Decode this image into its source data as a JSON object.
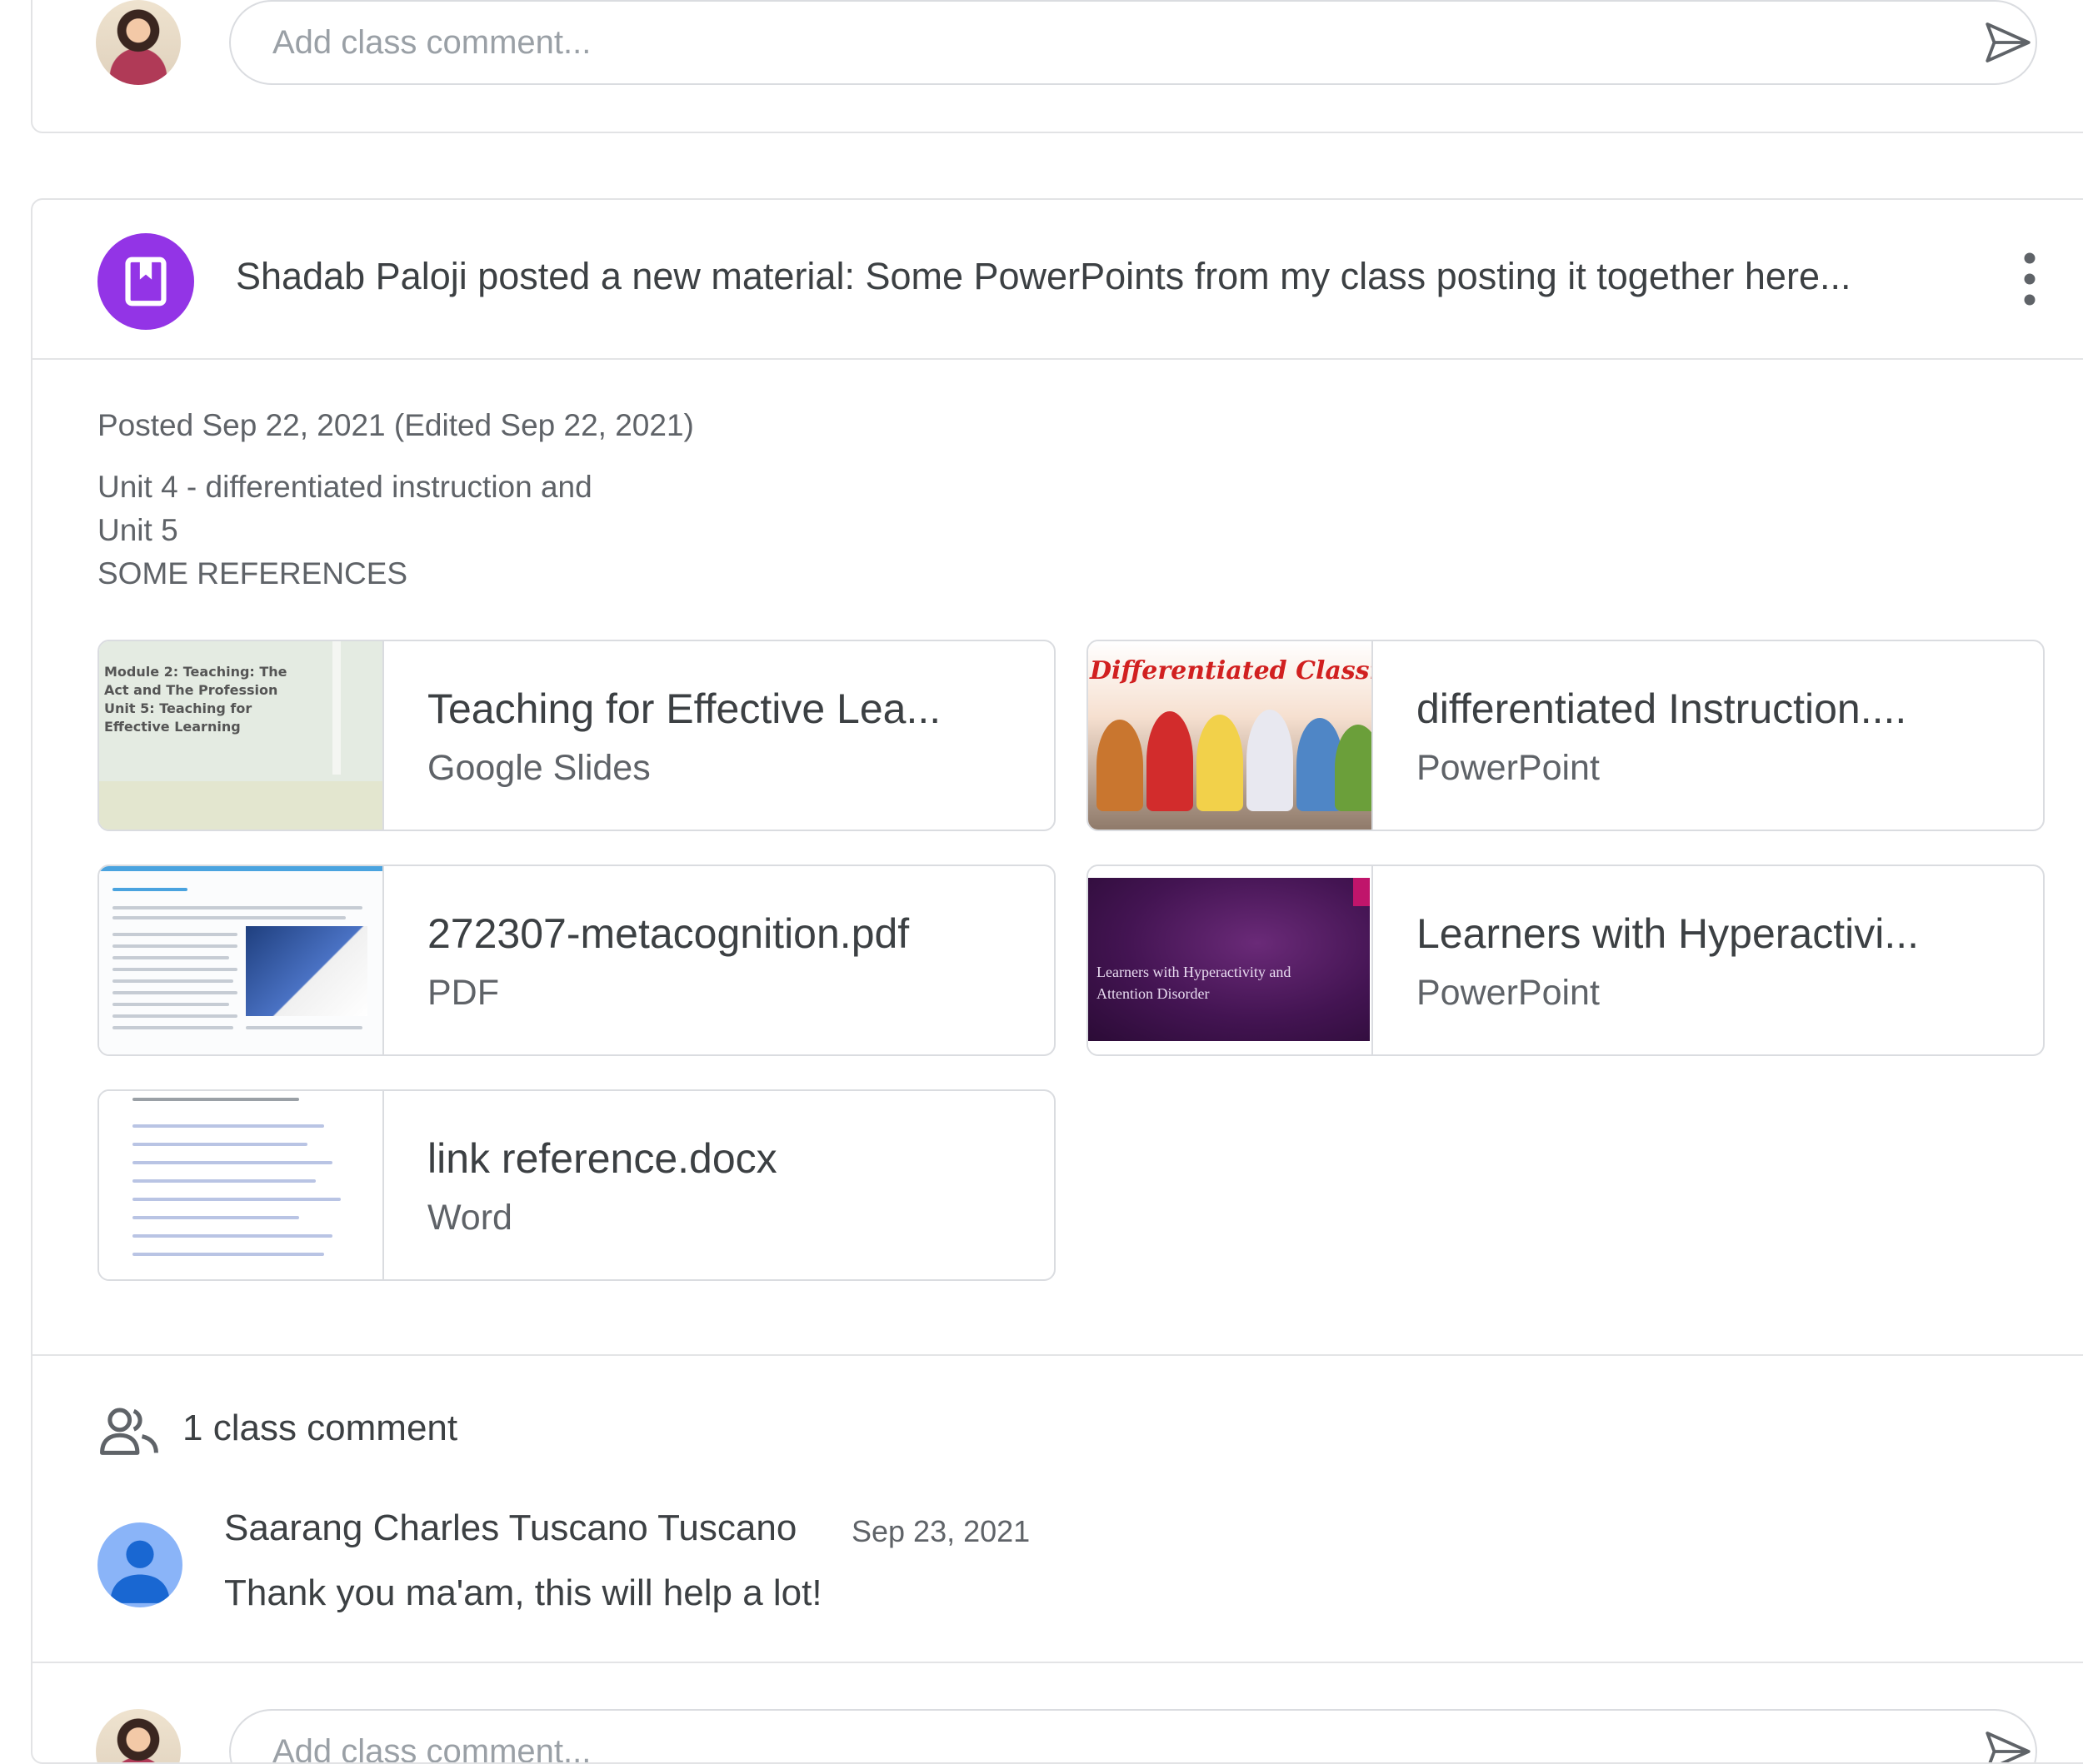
{
  "top_comment": {
    "placeholder": "Add class comment..."
  },
  "post": {
    "title": "Shadab Paloji posted a new material: Some PowerPoints from my class posting it together here...",
    "posted": "Posted Sep 22, 2021 (Edited Sep 22, 2021)",
    "description": [
      "Unit 4 - differentiated instruction and",
      "Unit 5",
      "SOME REFERENCES"
    ],
    "attachments": [
      {
        "title": "Teaching for Effective Lea...",
        "type": "Google Slides",
        "thumb_text": "Module 2: Teaching: The Act and The Profession Unit 5: Teaching for Effective Learning"
      },
      {
        "title": "differentiated Instruction....",
        "type": "PowerPoint",
        "thumb_text": "Differentiated Classr"
      },
      {
        "title": "272307-metacognition.pdf",
        "type": "PDF"
      },
      {
        "title": "Learners with Hyperactivi...",
        "type": "PowerPoint",
        "thumb_text": "Learners with Hyperactivity and Attention Disorder"
      },
      {
        "title": "link reference.docx",
        "type": "Word"
      }
    ]
  },
  "comments": {
    "count_label": "1 class comment",
    "items": [
      {
        "author": "Saarang Charles Tuscano Tuscano",
        "date": "Sep 23, 2021",
        "text": "Thank you ma'am, this will help a lot!"
      }
    ]
  },
  "bottom_comment": {
    "placeholder": "Add class comment..."
  },
  "colors": {
    "material_icon_bg": "#9334e6",
    "send_icon": "#5f6368",
    "text_primary": "#3c4043",
    "text_secondary": "#5f6368"
  },
  "icons": [
    "send-icon",
    "material-icon",
    "more-vert-icon",
    "people-icon",
    "person-icon"
  ]
}
